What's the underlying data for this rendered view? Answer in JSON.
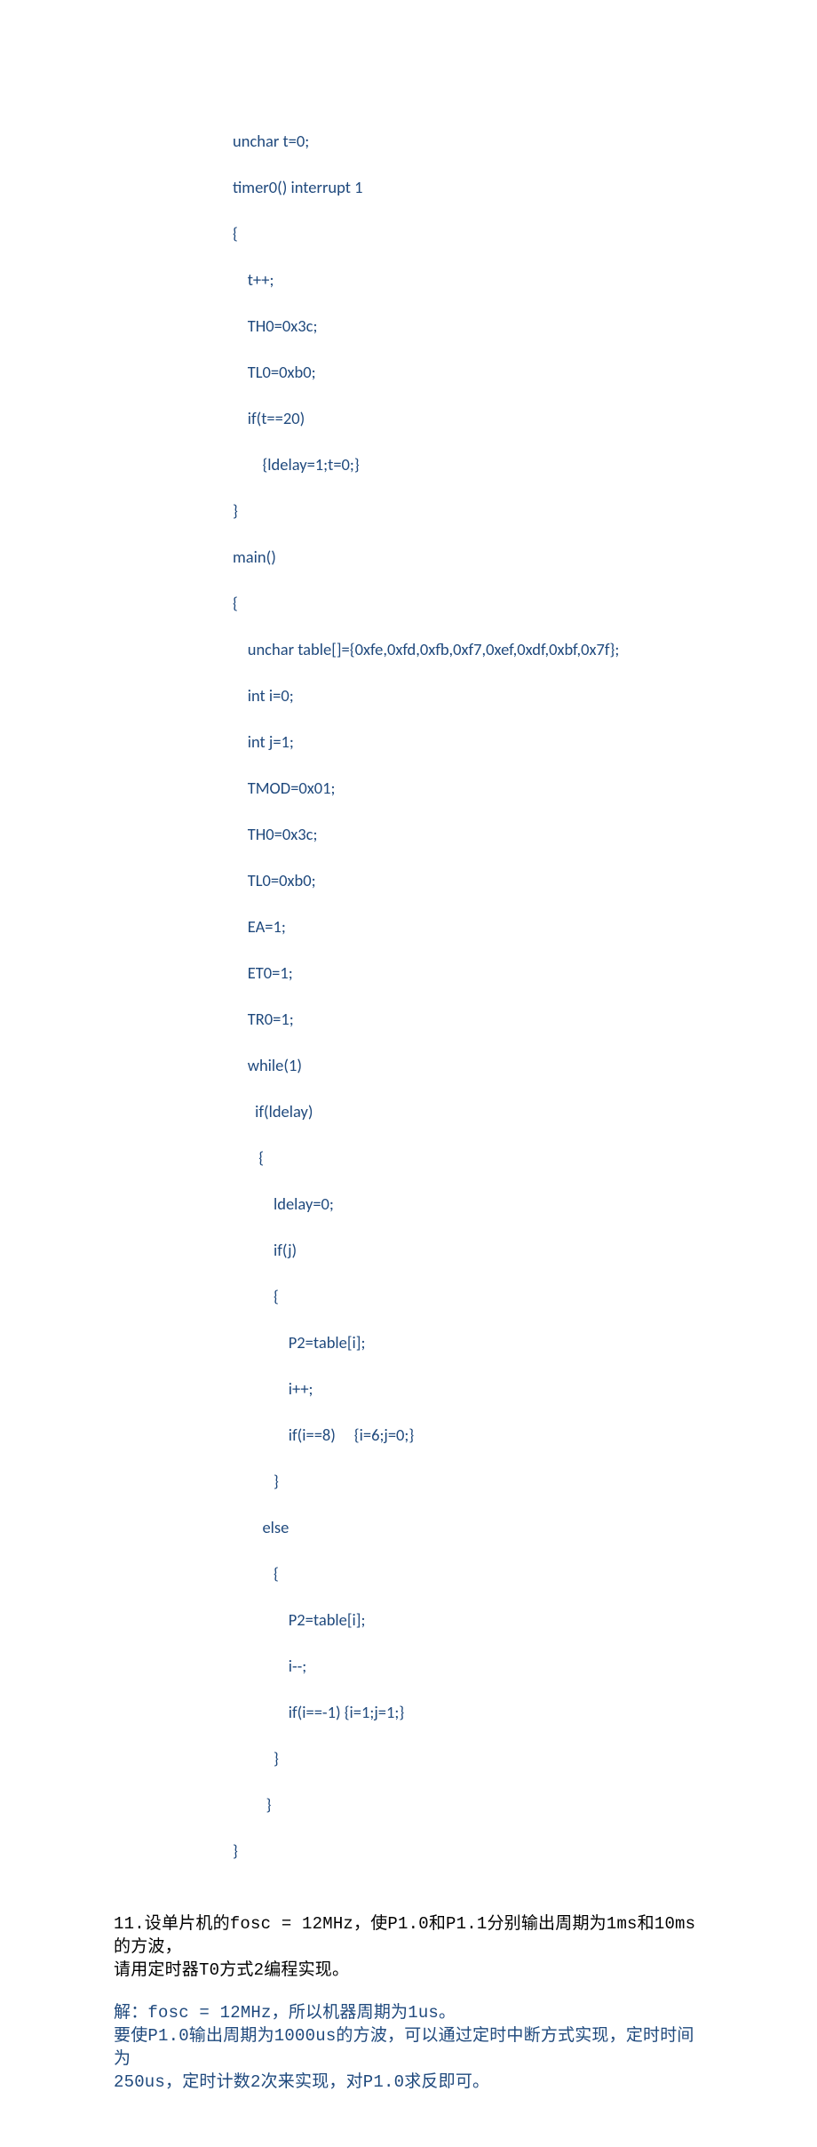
{
  "code": {
    "l01": "unchar t=0;",
    "l02": "timer0() interrupt 1",
    "l03": "{",
    "l04": "    t++;",
    "l05": "    TH0=0x3c;",
    "l06": "    TL0=0xb0;",
    "l07": "    if(t==20)",
    "l08": "        {ldelay=1;t=0;}",
    "l09": "}",
    "l10": "main()",
    "l11": "{",
    "l12": "    unchar table[]={0xfe,0xfd,0xfb,0xf7,0xef,0xdf,0xbf,0x7f};",
    "l13": "    int i=0;",
    "l14": "    int j=1;",
    "l15": "    TMOD=0x01;",
    "l16": "    TH0=0x3c;",
    "l17": "    TL0=0xb0;",
    "l18": "    EA=1;",
    "l19": "    ET0=1;",
    "l20": "    TR0=1;",
    "l21": "    while(1)",
    "l22": "      if(ldelay)",
    "l23": "       {",
    "l24": "           ldelay=0;",
    "l25": "           if(j)",
    "l26": "           {",
    "l27": "               P2=table[i];",
    "l28": "               i++;",
    "l29": "               if(i==8)     {i=6;j=0;}",
    "l30": "           }",
    "l31": "        else",
    "l32": "           {",
    "l33": "               P2=table[i];",
    "l34": "               i--;",
    "l35": "               if(i==-1) {i=1;j=1;}",
    "l36": "           }",
    "l37": "         }",
    "l38": "}"
  },
  "question": {
    "line1": "11.设单片机的fosc = 12MHz，使P1.0和P1.1分别输出周期为1ms和10ms的方波，",
    "line2": "请用定时器T0方式2编程实现。"
  },
  "answer": {
    "line1": "解：fosc = 12MHz，所以机器周期为1us。",
    "line2": "要使P1.0输出周期为1000us的方波，可以通过定时中断方式实现，定时时间为",
    "line3": "250us，定时计数2次来实现，对P1.0求反即可。"
  }
}
